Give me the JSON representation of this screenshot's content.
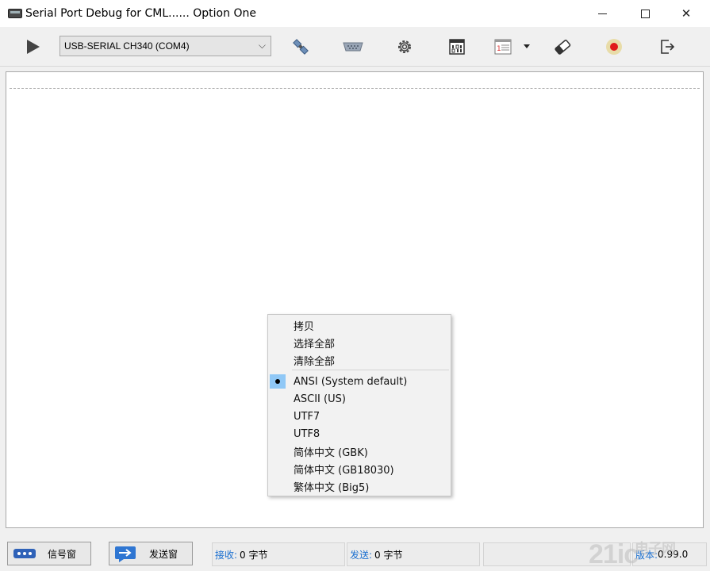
{
  "window": {
    "title": "Serial Port Debug for CML......  Option One",
    "icon": "serial-port-app-icon",
    "controls": [
      "minimize-icon",
      "maximize-icon",
      "close-icon"
    ],
    "close_glyph": "✕"
  },
  "toolbar": {
    "port_select": {
      "value": "USB-SERIAL CH340 (COM4)",
      "caret": "⌵"
    },
    "icons": [
      "play-icon",
      "plug-connect-icon",
      "serial-connector-icon",
      "settings-gear-icon",
      "binary-display-icon",
      "list-format-icon",
      "dropdown-arrow-icon",
      "eraser-icon",
      "record-icon",
      "exit-icon"
    ],
    "record_color": "#e01b1b"
  },
  "context_menu": {
    "items": [
      "拷贝",
      "选择全部",
      "清除全部"
    ],
    "encodings": [
      "ANSI (System default)",
      "ASCII (US)",
      "UTF7",
      "UTF8",
      "简体中文 (GBK)",
      "简体中文 (GB18030)",
      "繁体中文 (Big5)"
    ],
    "selected_encoding": "ANSI (System default)",
    "selected_highlight": "#90c8f6"
  },
  "statusbar": {
    "signal_button": "信号窗",
    "send_button": "发送窗",
    "receive_label": "接收:",
    "receive_value": "0 字节",
    "send_label": "发送:",
    "send_value": "0 字节",
    "version_label": "版本:",
    "version_value": "0.99.0",
    "label_color": "#1a6fd0"
  },
  "watermark": {
    "text": "21ic",
    "subtext": "电子网"
  }
}
